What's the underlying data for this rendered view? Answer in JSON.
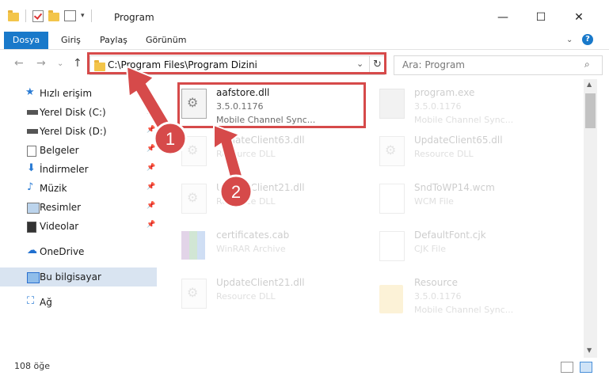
{
  "window": {
    "title": "Program",
    "minimize": "—",
    "maximize": "☐",
    "close": "✕"
  },
  "ribbon": {
    "tabs": [
      "Dosya",
      "Giriş",
      "Paylaş",
      "Görünüm"
    ],
    "help": "?",
    "collapse": "⌄"
  },
  "nav": {
    "back": "←",
    "forward": "→",
    "recent": "⌄",
    "up": "↑",
    "address": "C:\\Program Files\\Program Dizini",
    "address_dropdown": "⌄",
    "refresh": "↻",
    "search_placeholder": "Ara: Program"
  },
  "sidebar": {
    "items": [
      {
        "label": "Hızlı erişim",
        "icon": "star-icon",
        "pinned": false
      },
      {
        "label": "Yerel Disk (C:)",
        "icon": "drive-icon",
        "pinned": true
      },
      {
        "label": "Yerel Disk (D:)",
        "icon": "drive-icon",
        "pinned": true
      },
      {
        "label": "Belgeler",
        "icon": "documents-icon",
        "pinned": true
      },
      {
        "label": "İndirmeler",
        "icon": "download-icon",
        "pinned": true
      },
      {
        "label": "Müzik",
        "icon": "music-icon",
        "pinned": true
      },
      {
        "label": "Resimler",
        "icon": "pictures-icon",
        "pinned": true
      },
      {
        "label": "Videolar",
        "icon": "videos-icon",
        "pinned": true
      },
      {
        "label": "OneDrive",
        "icon": "onedrive-icon",
        "pinned": false
      },
      {
        "label": "Bu bilgisayar",
        "icon": "computer-icon",
        "pinned": false
      },
      {
        "label": "Ağ",
        "icon": "network-icon",
        "pinned": false
      }
    ]
  },
  "files": [
    {
      "name": "aafstore.dll",
      "line1": "3.5.0.1176",
      "line2": "Mobile Channel Sync...",
      "icon": "dll-icon",
      "highlight": true
    },
    {
      "name": "program.exe",
      "line1": "3.5.0.1176",
      "line2": "Mobile Channel Sync...",
      "icon": "exe-icon",
      "highlight": false
    },
    {
      "name": "UpdateClient63.dll",
      "line1": "Resource DLL",
      "line2": "",
      "icon": "dll-icon",
      "highlight": false
    },
    {
      "name": "UpdateClient65.dll",
      "line1": "Resource DLL",
      "line2": "",
      "icon": "dll-icon",
      "highlight": false
    },
    {
      "name": "UpdateClient21.dll",
      "line1": "Resource DLL",
      "line2": "",
      "icon": "dll-icon",
      "highlight": false
    },
    {
      "name": "SndToWP14.wcm",
      "line1": "WCM File",
      "line2": "",
      "icon": "doc-icon",
      "highlight": false
    },
    {
      "name": "certificates.cab",
      "line1": "WinRAR Archive",
      "line2": "",
      "icon": "rar-icon",
      "highlight": false
    },
    {
      "name": "DefaultFont.cjk",
      "line1": "CJK File",
      "line2": "",
      "icon": "doc-icon",
      "highlight": false
    },
    {
      "name": "UpdateClient21.dll",
      "line1": "Resource DLL",
      "line2": "",
      "icon": "dll-icon",
      "highlight": false
    },
    {
      "name": "Resource",
      "line1": "3.5.0.1176",
      "line2": "Mobile Channel Sync...",
      "icon": "folder-icon",
      "highlight": false
    }
  ],
  "status": {
    "count": "108 öğe"
  },
  "annotations": {
    "marker1": "1",
    "marker2": "2",
    "color": "#d64a4a"
  },
  "colors": {
    "accent": "#1979ca",
    "selection": "#d9e4f1",
    "highlight_red": "#d64a4a"
  }
}
